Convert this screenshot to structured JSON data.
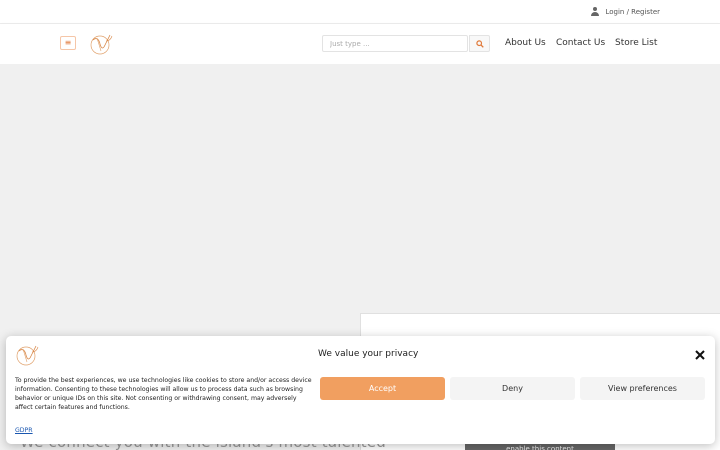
{
  "topbar": {
    "login_label": "Login / Register",
    "icon": "user-icon"
  },
  "header": {
    "menu_icon": "≡",
    "search": {
      "placeholder": "Just type ..."
    },
    "nav": [
      {
        "label": "About Us"
      },
      {
        "label": "Contact Us"
      },
      {
        "label": "Store List"
      }
    ]
  },
  "content": {
    "tagline": "We connect you with the island's most talented",
    "enable_label": "enable this content"
  },
  "cookie": {
    "title": "We value your privacy",
    "text": "To provide the best experiences, we use technologies like cookies to store and/or access device information. Consenting to these technologies will allow us to process data such as browsing behavior or unique IDs on this site. Not consenting or withdrawing consent, may adversely affect certain features and functions.",
    "gdpr_label": "GDPR",
    "accept_label": "Accept",
    "deny_label": "Deny",
    "prefs_label": "View preferences"
  },
  "colors": {
    "accent": "#f19f60",
    "logo": "#e0a06a"
  }
}
